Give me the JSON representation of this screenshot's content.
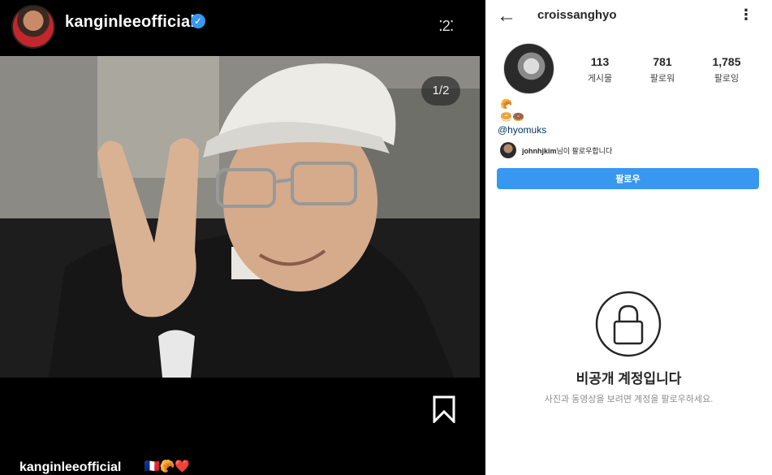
{
  "left_post": {
    "username": "kanginleeofficial",
    "verified_icon": "verified-check-icon",
    "more_label": "⁚2⁚",
    "photo_counter": "1/2",
    "caption_username": "kanginleeofficial",
    "caption_emojis": "🇫🇷🥐❤️"
  },
  "right_profile": {
    "back_icon": "back-arrow-icon",
    "username": "croissanghyo",
    "more_icon": "more-vertical-icon",
    "stats": [
      {
        "count": "113",
        "label": "게시물"
      },
      {
        "count": "781",
        "label": "팔로워"
      },
      {
        "count": "1,785",
        "label": "팔로잉"
      }
    ],
    "bio_line1": "🥐",
    "bio_line2": "🥯🍩",
    "bio_link": "@hyomuks",
    "followed_by_user": "johnhjkim",
    "followed_by_suffix": "님이 팔로우합니다",
    "follow_button": "팔로우",
    "private_title": "비공개 계정입니다",
    "private_subtitle": "사진과 동영상을 보려면 계정을 팔로우하세요."
  },
  "colors": {
    "follow_blue": "#3897f0",
    "link_blue": "#00376b"
  }
}
